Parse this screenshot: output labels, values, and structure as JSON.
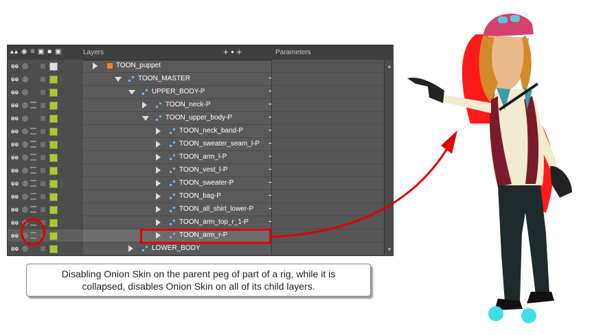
{
  "panel": {
    "header": {
      "icons": "▴▴ ◉ ≡ ▣ ■ ▣",
      "layers_label": "Layers",
      "add_icons": "+  •  +",
      "parameters_label": "Parameters"
    },
    "rows": [
      {
        "name": "TOON_puppet",
        "level": 0,
        "type": "group",
        "expander": "right",
        "swatch": "white",
        "full_ctrls": false,
        "plus": false
      },
      {
        "name": "TOON_MASTER",
        "level": 1,
        "type": "peg",
        "expander": "down",
        "swatch": "green",
        "full_ctrls": false,
        "plus": true
      },
      {
        "name": "UPPER_BODY-P",
        "level": 2,
        "type": "peg",
        "expander": "down",
        "swatch": "green",
        "full_ctrls": false,
        "plus": true
      },
      {
        "name": "TOON_neck-P",
        "level": 3,
        "type": "peg",
        "expander": "right",
        "swatch": "green",
        "full_ctrls": true,
        "plus": true
      },
      {
        "name": "TOON_upper_body-P",
        "level": 3,
        "type": "peg",
        "expander": "down",
        "swatch": "green",
        "full_ctrls": false,
        "plus": true
      },
      {
        "name": "TOON_neck_band-P",
        "level": 4,
        "type": "peg",
        "expander": "right",
        "swatch": "green",
        "full_ctrls": true,
        "plus": true
      },
      {
        "name": "TOON_sweater_seam_l-P",
        "level": 4,
        "type": "peg",
        "expander": "right",
        "swatch": "green",
        "full_ctrls": true,
        "plus": true
      },
      {
        "name": "TOON_arm_l-P",
        "level": 4,
        "type": "peg",
        "expander": "right",
        "swatch": "green",
        "full_ctrls": true,
        "plus": true
      },
      {
        "name": "TOON_vest_l-P",
        "level": 4,
        "type": "peg",
        "expander": "right",
        "swatch": "green",
        "full_ctrls": true,
        "plus": true
      },
      {
        "name": "TOON_sweater-P",
        "level": 4,
        "type": "peg",
        "expander": "right",
        "swatch": "green",
        "full_ctrls": true,
        "plus": true
      },
      {
        "name": "TOON_bag-P",
        "level": 4,
        "type": "peg",
        "expander": "right",
        "swatch": "green",
        "full_ctrls": true,
        "plus": true
      },
      {
        "name": "TOON_all_shirt_lower-P",
        "level": 4,
        "type": "peg",
        "expander": "right",
        "swatch": "green",
        "full_ctrls": true,
        "plus": true
      },
      {
        "name": "TOON_arm_top_r_1-P",
        "level": 4,
        "type": "peg",
        "expander": "right",
        "swatch": "green",
        "full_ctrls": true,
        "plus": true
      },
      {
        "name": "TOON_arm_r-P",
        "level": 4,
        "type": "peg",
        "expander": "right",
        "swatch": "green",
        "full_ctrls": true,
        "plus": true,
        "selected": true
      },
      {
        "name": "LOWER_BODY",
        "level": 2,
        "type": "peg",
        "expander": "right",
        "swatch": "green",
        "full_ctrls": false,
        "plus": false
      }
    ]
  },
  "callout": {
    "line1": "Disabling Onion Skin on the parent peg of part of a rig, while it is",
    "line2": "collapsed, disables Onion Skin on all of its child layers."
  },
  "colors": {
    "highlight": "#e00000",
    "layer_swatch": "#a9c93a",
    "peg_icon": "#6db1ff"
  }
}
